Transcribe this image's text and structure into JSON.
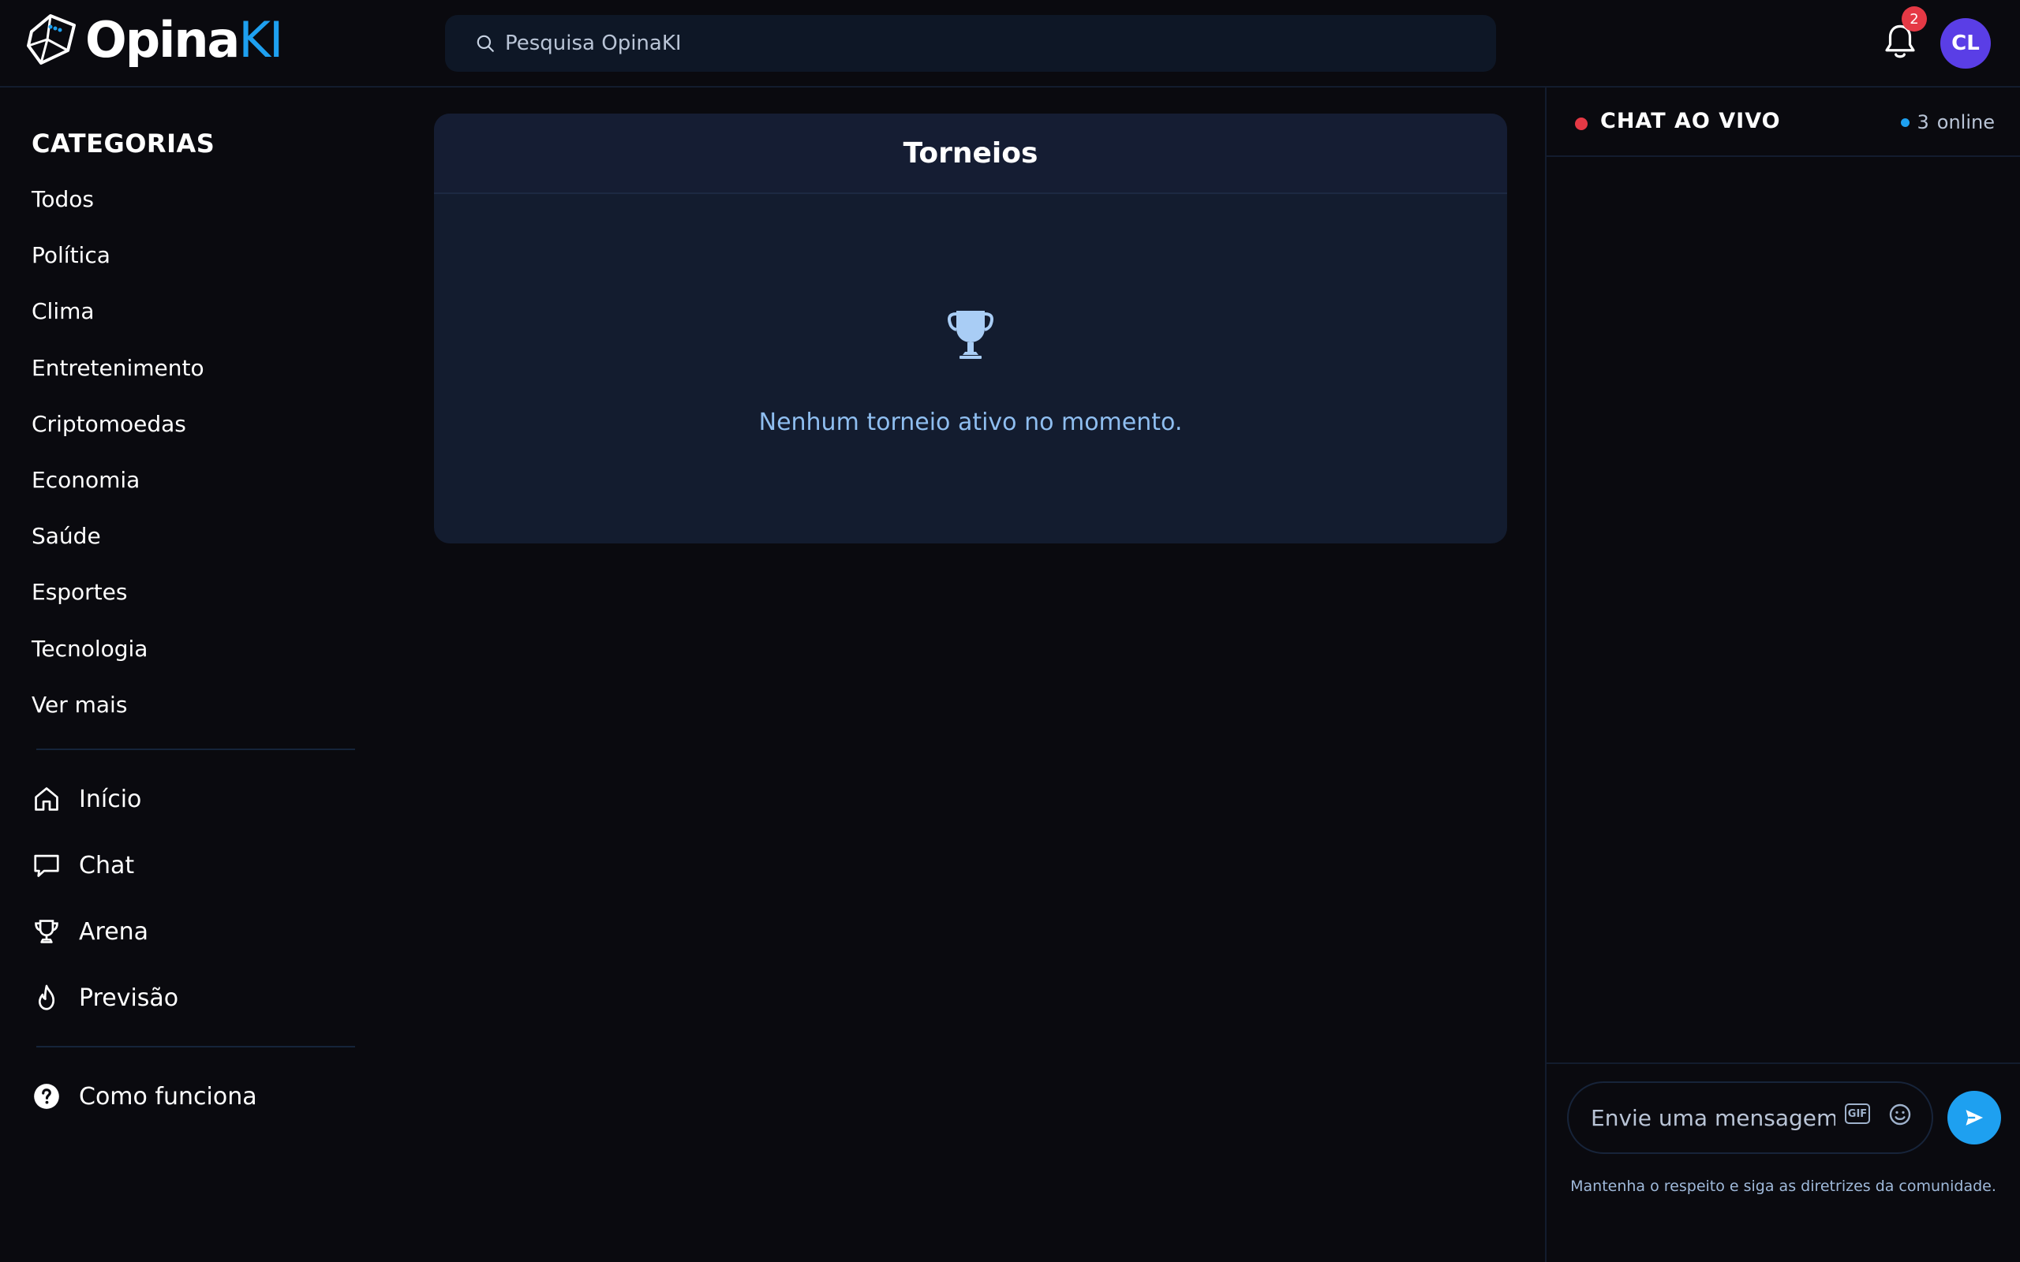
{
  "header": {
    "logo_main": "Opina",
    "logo_accent": "KI",
    "search_placeholder": "Pesquisa OpinaKI",
    "notification_count": "2",
    "avatar_initials": "CL"
  },
  "sidebar": {
    "categories_title": "CATEGORIAS",
    "categories": [
      "Todos",
      "Política",
      "Clima",
      "Entretenimento",
      "Criptomoedas",
      "Economia",
      "Saúde",
      "Esportes",
      "Tecnologia",
      "Ver mais"
    ],
    "nav": [
      {
        "label": "Início",
        "icon": "home-icon"
      },
      {
        "label": "Chat",
        "icon": "chat-icon"
      },
      {
        "label": "Arena",
        "icon": "trophy-icon"
      },
      {
        "label": "Previsão",
        "icon": "flame-icon"
      }
    ],
    "help": {
      "label": "Como funciona",
      "icon": "help-icon"
    }
  },
  "main": {
    "card_title": "Torneios",
    "empty_message": "Nenhum torneio ativo no momento."
  },
  "chat": {
    "title": "CHAT AO VIVO",
    "online_count": "3",
    "online_label": "online",
    "input_placeholder": "Envie uma mensagem...",
    "gif_label": "GIF",
    "guideline": "Mantenha o respeito e siga as diretrizes da comunidade."
  },
  "colors": {
    "background": "#0a0a0f",
    "accent": "#1ea0f0",
    "live": "#e53945",
    "avatar": "#5a3ee6",
    "card": "#131c2f"
  }
}
